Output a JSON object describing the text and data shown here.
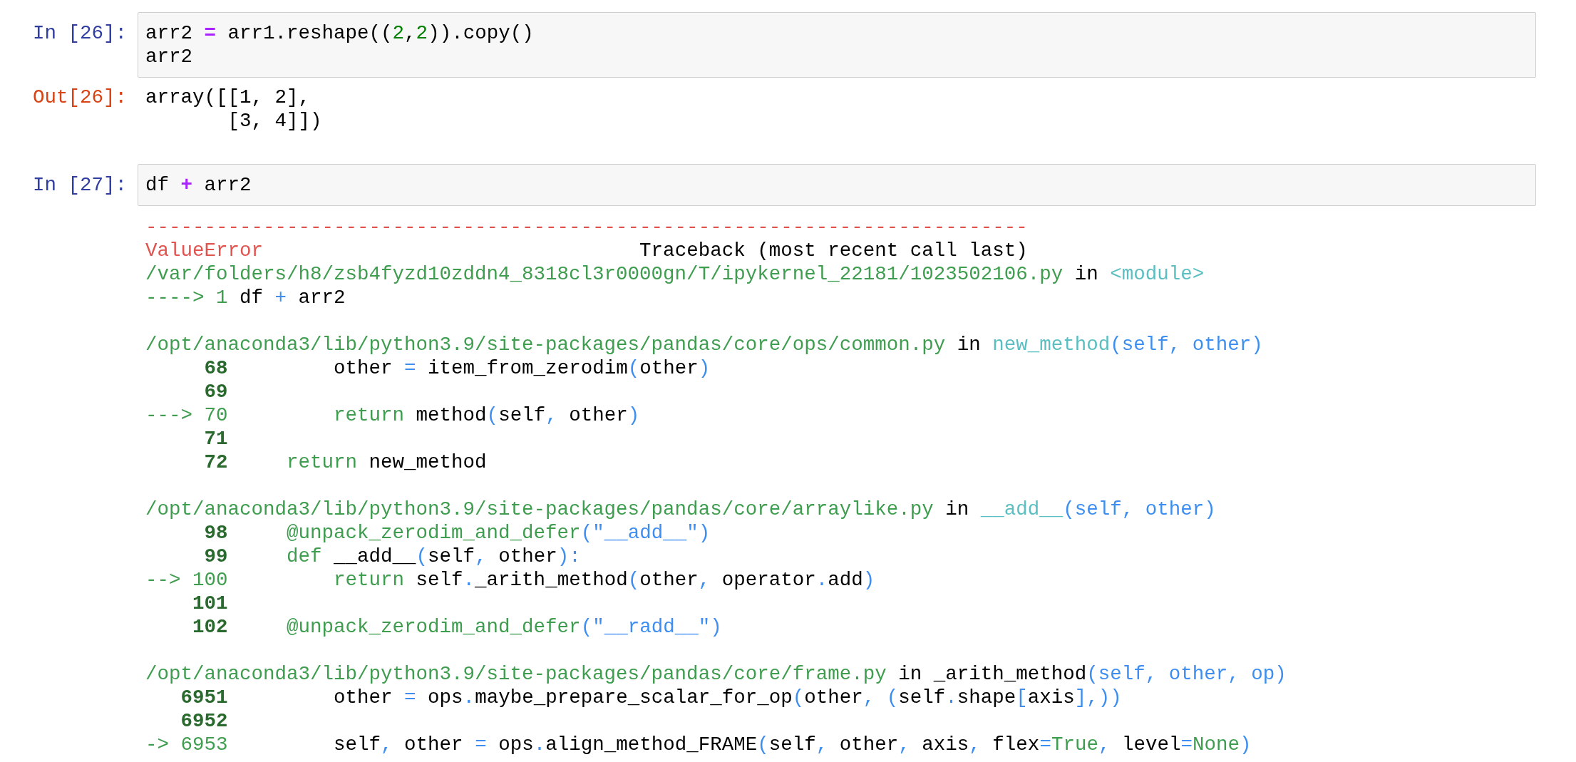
{
  "cells": [
    {
      "kind": "input",
      "prompt": "In [26]:",
      "lines": [
        {
          "kind": "code",
          "segments": [
            {
              "text": "arr2 ",
              "kind": "plain"
            },
            {
              "text": "=",
              "kind": "op"
            },
            {
              "text": " arr1.reshape((",
              "kind": "plain"
            },
            {
              "text": "2",
              "kind": "num"
            },
            {
              "text": ",",
              "kind": "plain"
            },
            {
              "text": "2",
              "kind": "num"
            },
            {
              "text": ")).copy()",
              "kind": "plain"
            }
          ]
        },
        {
          "kind": "code",
          "segments": [
            {
              "text": "arr2",
              "kind": "plain"
            }
          ]
        }
      ]
    },
    {
      "kind": "output",
      "prompt": "Out[26]:",
      "lines": [
        {
          "kind": "code",
          "segments": [
            {
              "text": "array([[1, 2],",
              "kind": "plain"
            }
          ]
        },
        {
          "kind": "code",
          "segments": [
            {
              "text": "       [3, 4]])",
              "kind": "plain"
            }
          ]
        }
      ]
    },
    {
      "kind": "input",
      "prompt": "In [27]:",
      "lines": [
        {
          "kind": "code",
          "segments": [
            {
              "text": "df ",
              "kind": "plain"
            },
            {
              "text": "+",
              "kind": "op"
            },
            {
              "text": " arr2",
              "kind": "plain"
            }
          ]
        }
      ]
    },
    {
      "kind": "traceback",
      "lines": [
        {
          "kind": "code",
          "segments": [
            {
              "text": "---------------------------------------------------------------------------",
              "kind": "error"
            }
          ]
        },
        {
          "kind": "code",
          "segments": [
            {
              "text": "ValueError",
              "kind": "error"
            },
            {
              "text": "                                Traceback (most recent call last)",
              "kind": "plain"
            }
          ]
        },
        {
          "kind": "code",
          "segments": [
            {
              "text": "/var/folders/h8/zsb4fyzd10zddn4_8318cl3r0000gn/T/ipykernel_22181/1023502106.py",
              "kind": "path"
            },
            {
              "text": " in ",
              "kind": "plain"
            },
            {
              "text": "<module>",
              "kind": "name"
            }
          ]
        },
        {
          "kind": "code",
          "segments": [
            {
              "text": "----> 1",
              "kind": "path"
            },
            {
              "text": " df ",
              "kind": "plain"
            },
            {
              "text": "+",
              "kind": "punct"
            },
            {
              "text": " arr2",
              "kind": "plain"
            }
          ]
        },
        {
          "kind": "blank"
        },
        {
          "kind": "code",
          "segments": [
            {
              "text": "/opt/anaconda3/lib/python3.9/site-packages/pandas/core/ops/common.py",
              "kind": "path"
            },
            {
              "text": " in ",
              "kind": "plain"
            },
            {
              "text": "new_method",
              "kind": "name"
            },
            {
              "text": "(self, other)",
              "kind": "punct"
            }
          ]
        },
        {
          "kind": "code",
          "segments": [
            {
              "text": "     68",
              "kind": "lineno"
            },
            {
              "text": "         other ",
              "kind": "plain"
            },
            {
              "text": "=",
              "kind": "punct"
            },
            {
              "text": " item_from_zerodim",
              "kind": "plain"
            },
            {
              "text": "(",
              "kind": "punct"
            },
            {
              "text": "other",
              "kind": "plain"
            },
            {
              "text": ")",
              "kind": "punct"
            }
          ]
        },
        {
          "kind": "code",
          "segments": [
            {
              "text": "     69",
              "kind": "lineno"
            }
          ]
        },
        {
          "kind": "code",
          "segments": [
            {
              "text": "---> 70",
              "kind": "path"
            },
            {
              "text": "         return",
              "kind": "path"
            },
            {
              "text": " method",
              "kind": "plain"
            },
            {
              "text": "(",
              "kind": "punct"
            },
            {
              "text": "self",
              "kind": "plain"
            },
            {
              "text": ",",
              "kind": "punct"
            },
            {
              "text": " other",
              "kind": "plain"
            },
            {
              "text": ")",
              "kind": "punct"
            }
          ]
        },
        {
          "kind": "code",
          "segments": [
            {
              "text": "     71",
              "kind": "lineno"
            }
          ]
        },
        {
          "kind": "code",
          "segments": [
            {
              "text": "     72",
              "kind": "lineno"
            },
            {
              "text": "     return",
              "kind": "path"
            },
            {
              "text": " new_method",
              "kind": "plain"
            }
          ]
        },
        {
          "kind": "blank"
        },
        {
          "kind": "code",
          "segments": [
            {
              "text": "/opt/anaconda3/lib/python3.9/site-packages/pandas/core/arraylike.py",
              "kind": "path"
            },
            {
              "text": " in ",
              "kind": "plain"
            },
            {
              "text": "__add__",
              "kind": "name"
            },
            {
              "text": "(self, other)",
              "kind": "punct"
            }
          ]
        },
        {
          "kind": "code",
          "segments": [
            {
              "text": "     98",
              "kind": "lineno"
            },
            {
              "text": "     @unpack_zerodim_and_defer",
              "kind": "path"
            },
            {
              "text": "(\"__add__\")",
              "kind": "punct"
            }
          ]
        },
        {
          "kind": "code",
          "segments": [
            {
              "text": "     99",
              "kind": "lineno"
            },
            {
              "text": "     def",
              "kind": "path"
            },
            {
              "text": " __add__",
              "kind": "plain"
            },
            {
              "text": "(",
              "kind": "punct"
            },
            {
              "text": "self",
              "kind": "plain"
            },
            {
              "text": ",",
              "kind": "punct"
            },
            {
              "text": " other",
              "kind": "plain"
            },
            {
              "text": "):",
              "kind": "punct"
            }
          ]
        },
        {
          "kind": "code",
          "segments": [
            {
              "text": "--> 100",
              "kind": "path"
            },
            {
              "text": "         return",
              "kind": "path"
            },
            {
              "text": " self",
              "kind": "plain"
            },
            {
              "text": ".",
              "kind": "punct"
            },
            {
              "text": "_arith_method",
              "kind": "plain"
            },
            {
              "text": "(",
              "kind": "punct"
            },
            {
              "text": "other",
              "kind": "plain"
            },
            {
              "text": ",",
              "kind": "punct"
            },
            {
              "text": " operator",
              "kind": "plain"
            },
            {
              "text": ".",
              "kind": "punct"
            },
            {
              "text": "add",
              "kind": "plain"
            },
            {
              "text": ")",
              "kind": "punct"
            }
          ]
        },
        {
          "kind": "code",
          "segments": [
            {
              "text": "    101",
              "kind": "lineno"
            }
          ]
        },
        {
          "kind": "code",
          "segments": [
            {
              "text": "    102",
              "kind": "lineno"
            },
            {
              "text": "     @unpack_zerodim_and_defer",
              "kind": "path"
            },
            {
              "text": "(\"__radd__\")",
              "kind": "punct"
            }
          ]
        },
        {
          "kind": "blank"
        },
        {
          "kind": "code",
          "segments": [
            {
              "text": "/opt/anaconda3/lib/python3.9/site-packages/pandas/core/frame.py",
              "kind": "path"
            },
            {
              "text": " in ",
              "kind": "plain"
            },
            {
              "text": "_arith_method",
              "kind": "plain"
            },
            {
              "text": "(self, other, op)",
              "kind": "punct"
            }
          ]
        },
        {
          "kind": "code",
          "segments": [
            {
              "text": "   6951",
              "kind": "lineno"
            },
            {
              "text": "         other ",
              "kind": "plain"
            },
            {
              "text": "=",
              "kind": "punct"
            },
            {
              "text": " ops",
              "kind": "plain"
            },
            {
              "text": ".",
              "kind": "punct"
            },
            {
              "text": "maybe_prepare_scalar_for_op",
              "kind": "plain"
            },
            {
              "text": "(",
              "kind": "punct"
            },
            {
              "text": "other",
              "kind": "plain"
            },
            {
              "text": ", (",
              "kind": "punct"
            },
            {
              "text": "self",
              "kind": "plain"
            },
            {
              "text": ".",
              "kind": "punct"
            },
            {
              "text": "shape",
              "kind": "plain"
            },
            {
              "text": "[",
              "kind": "punct"
            },
            {
              "text": "axis",
              "kind": "plain"
            },
            {
              "text": "],))",
              "kind": "punct"
            }
          ]
        },
        {
          "kind": "code",
          "segments": [
            {
              "text": "   6952",
              "kind": "lineno"
            }
          ]
        },
        {
          "kind": "code",
          "segments": [
            {
              "text": "-> 6953",
              "kind": "path"
            },
            {
              "text": "         self",
              "kind": "plain"
            },
            {
              "text": ",",
              "kind": "punct"
            },
            {
              "text": " other ",
              "kind": "plain"
            },
            {
              "text": "=",
              "kind": "punct"
            },
            {
              "text": " ops",
              "kind": "plain"
            },
            {
              "text": ".",
              "kind": "punct"
            },
            {
              "text": "align_method_FRAME",
              "kind": "plain"
            },
            {
              "text": "(",
              "kind": "punct"
            },
            {
              "text": "self",
              "kind": "plain"
            },
            {
              "text": ",",
              "kind": "punct"
            },
            {
              "text": " other",
              "kind": "plain"
            },
            {
              "text": ",",
              "kind": "punct"
            },
            {
              "text": " axis",
              "kind": "plain"
            },
            {
              "text": ",",
              "kind": "punct"
            },
            {
              "text": " flex",
              "kind": "plain"
            },
            {
              "text": "=",
              "kind": "punct"
            },
            {
              "text": "True",
              "kind": "path"
            },
            {
              "text": ",",
              "kind": "punct"
            },
            {
              "text": " level",
              "kind": "plain"
            },
            {
              "text": "=",
              "kind": "punct"
            },
            {
              "text": "None",
              "kind": "path"
            },
            {
              "text": ")",
              "kind": "punct"
            }
          ]
        }
      ]
    }
  ]
}
